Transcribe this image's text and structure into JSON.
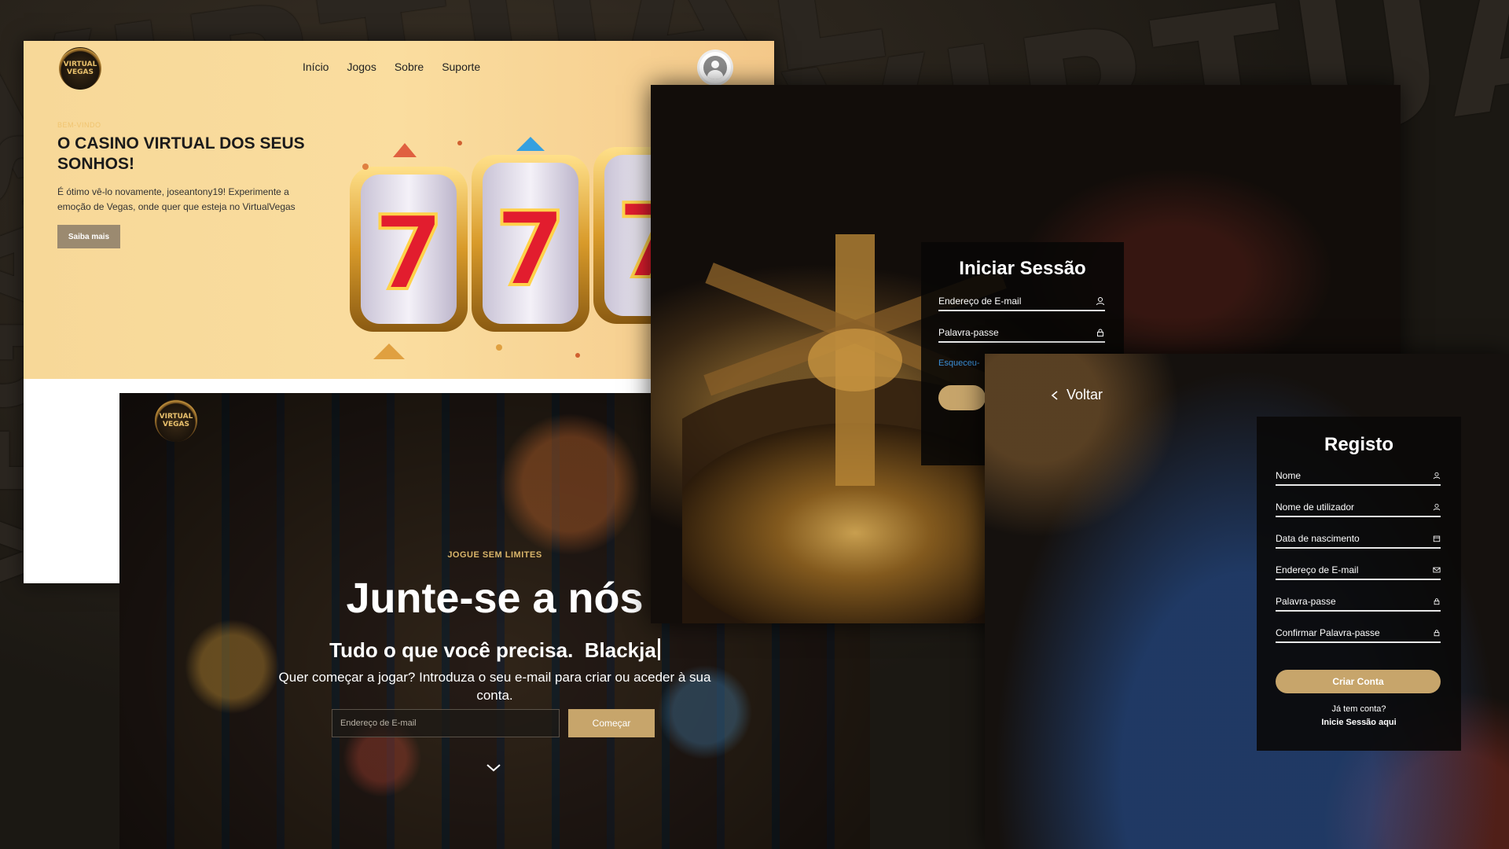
{
  "background": {
    "words": [
      "VIRTUAL",
      "VEGAS"
    ]
  },
  "logo": {
    "text": "VIRTUAL VEGAS"
  },
  "landing": {
    "nav": [
      "Início",
      "Jogos",
      "Sobre",
      "Suporte"
    ],
    "welcome_small": "BEM-VINDO",
    "title": "O CASINO VIRTUAL DOS SEUS SONHOS!",
    "text": "É ótimo vê-lo novamente, joseantony19! Experimente a emoção de Vegas, onde quer que esteja no VirtualVegas",
    "button": "Saiba mais"
  },
  "join": {
    "small": "JOGUE SEM LIMITES",
    "title": "Junte-se a nós",
    "subtitle": "Tudo o que você precisa.",
    "typed": "Blackja",
    "text": "Quer começar a jogar? Introduza o seu e-mail para criar ou aceder à sua conta.",
    "email_placeholder": "Endereço de E-mail",
    "button": "Começar"
  },
  "login": {
    "title": "Iniciar Sessão",
    "email_label": "Endereço de E-mail",
    "password_label": "Palavra-passe",
    "forgot": "Esqueceu-"
  },
  "register": {
    "back": "Voltar",
    "title": "Registo",
    "fields": [
      {
        "label": "Nome",
        "icon": "user-icon"
      },
      {
        "label": "Nome de utilizador",
        "icon": "user-icon"
      },
      {
        "label": "Data de nascimento",
        "icon": "calendar-icon"
      },
      {
        "label": "Endereço de E-mail",
        "icon": "mail-icon"
      },
      {
        "label": "Palavra-passe",
        "icon": "lock-icon"
      },
      {
        "label": "Confirmar Palavra-passe",
        "icon": "lock-icon"
      }
    ],
    "button": "Criar Conta",
    "has_account": "Já tem conta?",
    "login_link": "Inicie Sessão aqui"
  },
  "colors": {
    "accent": "#c7a56b",
    "link": "#3b8fd8",
    "hero_bg": "#fadd9f"
  }
}
